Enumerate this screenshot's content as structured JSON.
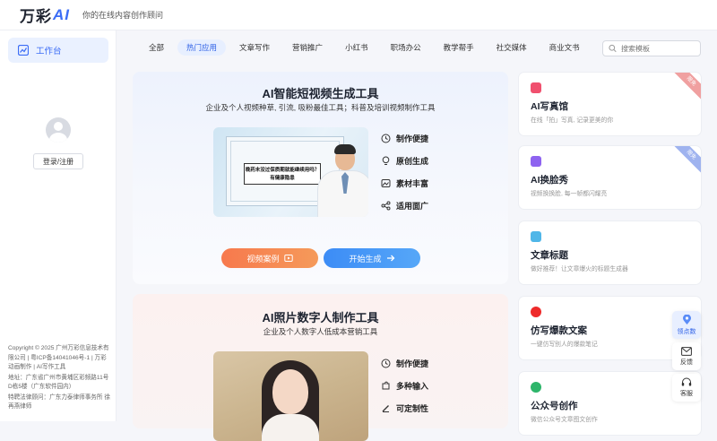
{
  "header": {
    "logo_text": "万彩",
    "logo_ai": "AI",
    "tagline": "你的在线内容创作顾问"
  },
  "sidebar": {
    "workbench_label": "工作台",
    "login_label": "登录/注册",
    "footer": [
      "Copyright © 2025 广州万彩信息技术有限公司 | 粤ICP备14041046号-1 | 万彩动画制作 | AI写作工具",
      "地址：广东省广州市黄埔区彩频路11号D栋5楼（广东软件园内）",
      "特聘法律顾问：广东力泰律师事务所 徐再燕律师"
    ]
  },
  "tabs": [
    "全部",
    "热门应用",
    "文章写作",
    "营销推广",
    "小红书",
    "职场办公",
    "教学帮手",
    "社交媒体",
    "商业文书"
  ],
  "active_tab": "热门应用",
  "search": {
    "placeholder": "搜索模板"
  },
  "card1": {
    "title": "AI智能短视频生成工具",
    "subtitle": "企业及个人视频种草, 引流, 吸粉最佳工具；科普及培训视频制作工具",
    "video_caption": "晚药未没过保质期就能继续用吗？有健康隐患",
    "features": [
      "制作便捷",
      "原创生成",
      "素材丰富",
      "适用面广"
    ],
    "btn_case": "视频案例",
    "btn_start": "开始生成"
  },
  "card2": {
    "title": "AI照片数字人制作工具",
    "subtitle": "企业及个人数字人低成本营销工具",
    "features": [
      "制作便捷",
      "多种输入",
      "可定制性"
    ]
  },
  "tools": [
    {
      "name": "AI写真馆",
      "desc": "在线「拍」写真, 记录更美的你",
      "ribbon": "限免",
      "color": "#f0506e",
      "ribbon_color": "#f0a0a0"
    },
    {
      "name": "AI换脸秀",
      "desc": "视频换换脸, 每一帧都闪耀亮",
      "ribbon": "限免",
      "color": "#8e63f0",
      "ribbon_color": "#9fb3ef"
    },
    {
      "name": "文章标题",
      "desc": "做好推荐！让文章爆火的标题生成器",
      "ribbon": "",
      "color": "#4fb6e8",
      "ribbon_color": ""
    },
    {
      "name": "仿写爆款文案",
      "desc": "一键仿写别人的爆款笔记",
      "ribbon": "",
      "color": "#ee2a2a",
      "ribbon_color": ""
    },
    {
      "name": "公众号创作",
      "desc": "微信公众号文章图文创作",
      "ribbon": "",
      "color": "#2db56a",
      "ribbon_color": ""
    }
  ],
  "float": {
    "points": "领点数",
    "feedback": "反馈",
    "service": "客服"
  }
}
